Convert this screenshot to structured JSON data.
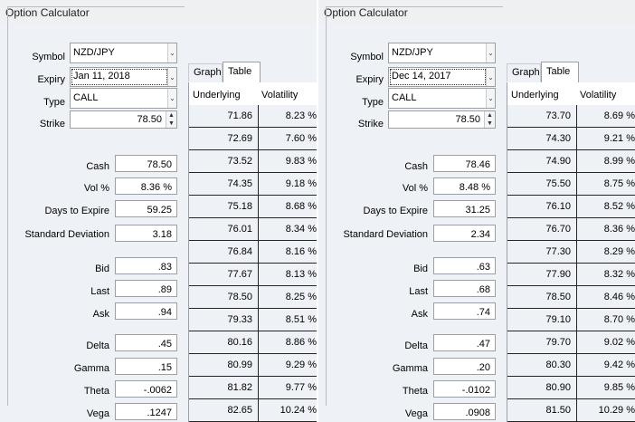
{
  "windows": [
    {
      "title": "Option Calculator",
      "symbol": {
        "label": "Symbol",
        "value": "NZD/JPY"
      },
      "expiry": {
        "label": "Expiry",
        "value": "Jan 11, 2018"
      },
      "type": {
        "label": "Type",
        "value": "CALL"
      },
      "strike": {
        "label": "Strike",
        "value": "78.50"
      },
      "fields": [
        {
          "label": "Cash",
          "value": "78.50"
        },
        {
          "label": "Vol %",
          "value": "8.36 %"
        },
        {
          "label": "Days to Expire",
          "value": "59.25"
        },
        {
          "label": "Standard Deviation",
          "value": "3.18"
        },
        {
          "label": "Bid",
          "value": ".83"
        },
        {
          "label": "Last",
          "value": ".89"
        },
        {
          "label": "Ask",
          "value": ".94"
        },
        {
          "label": "Delta",
          "value": ".45"
        },
        {
          "label": "Gamma",
          "value": ".15"
        },
        {
          "label": "Theta",
          "value": "-.0062"
        },
        {
          "label": "Vega",
          "value": ".1247"
        }
      ],
      "tabs": [
        "Graph",
        "Table"
      ],
      "table": {
        "headers": [
          "Underlying",
          "Volatility"
        ],
        "rows": [
          [
            "71.86",
            "8.23 %"
          ],
          [
            "72.69",
            "7.60 %"
          ],
          [
            "73.52",
            "9.83 %"
          ],
          [
            "74.35",
            "9.18 %"
          ],
          [
            "75.18",
            "8.68 %"
          ],
          [
            "76.01",
            "8.34 %"
          ],
          [
            "76.84",
            "8.16 %"
          ],
          [
            "77.67",
            "8.13 %"
          ],
          [
            "78.50",
            "8.25 %"
          ],
          [
            "79.33",
            "8.51 %"
          ],
          [
            "80.16",
            "8.86 %"
          ],
          [
            "80.99",
            "9.29 %"
          ],
          [
            "81.82",
            "9.77 %"
          ],
          [
            "82.65",
            "10.24 %"
          ]
        ]
      }
    },
    {
      "title": "Option Calculator",
      "symbol": {
        "label": "Symbol",
        "value": "NZD/JPY"
      },
      "expiry": {
        "label": "Expiry",
        "value": "Dec 14, 2017"
      },
      "type": {
        "label": "Type",
        "value": "CALL"
      },
      "strike": {
        "label": "Strike",
        "value": "78.50"
      },
      "fields": [
        {
          "label": "Cash",
          "value": "78.46"
        },
        {
          "label": "Vol %",
          "value": "8.48 %"
        },
        {
          "label": "Days to Expire",
          "value": "31.25"
        },
        {
          "label": "Standard Deviation",
          "value": "2.34"
        },
        {
          "label": "Bid",
          "value": ".63"
        },
        {
          "label": "Last",
          "value": ".68"
        },
        {
          "label": "Ask",
          "value": ".74"
        },
        {
          "label": "Delta",
          "value": ".47"
        },
        {
          "label": "Gamma",
          "value": ".20"
        },
        {
          "label": "Theta",
          "value": "-.0102"
        },
        {
          "label": "Vega",
          "value": ".0908"
        }
      ],
      "tabs": [
        "Graph",
        "Table"
      ],
      "table": {
        "headers": [
          "Underlying",
          "Volatility"
        ],
        "rows": [
          [
            "73.70",
            "8.69 %"
          ],
          [
            "74.30",
            "9.21 %"
          ],
          [
            "74.90",
            "8.99 %"
          ],
          [
            "75.50",
            "8.75 %"
          ],
          [
            "76.10",
            "8.52 %"
          ],
          [
            "76.70",
            "8.36 %"
          ],
          [
            "77.30",
            "8.29 %"
          ],
          [
            "77.90",
            "8.32 %"
          ],
          [
            "78.50",
            "8.46 %"
          ],
          [
            "79.10",
            "8.70 %"
          ],
          [
            "79.70",
            "9.02 %"
          ],
          [
            "80.30",
            "9.42 %"
          ],
          [
            "80.90",
            "9.85 %"
          ],
          [
            "81.50",
            "10.29 %"
          ]
        ]
      }
    }
  ]
}
